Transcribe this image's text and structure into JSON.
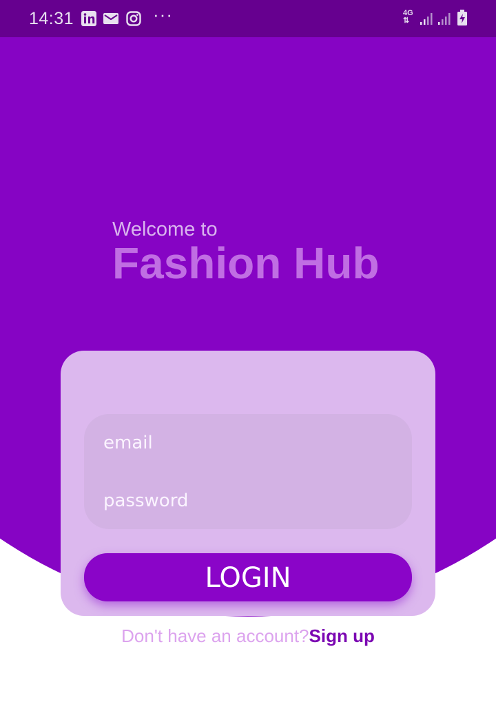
{
  "status_bar": {
    "time": "14:31",
    "notification_icons": [
      "linkedin-icon",
      "email-icon",
      "instagram-icon"
    ],
    "more_indicator": "···",
    "network_label": "4G",
    "color": "#66008f"
  },
  "hero": {
    "welcome_text": "Welcome to",
    "app_name": "Fashion Hub"
  },
  "login_form": {
    "email_placeholder": "email",
    "password_placeholder": "password",
    "login_label": "LOGIN"
  },
  "signup": {
    "prompt": "Don't have an account?",
    "link_label": "Sign up"
  },
  "colors": {
    "primary": "#8604c4",
    "card": "#dcb8ee",
    "accent_text": "#7b06b2"
  }
}
